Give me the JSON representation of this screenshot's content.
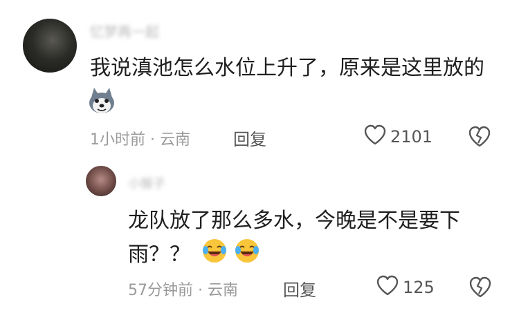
{
  "comments": [
    {
      "author": "忆梦再一起",
      "text": "我说滇池怎么水位上升了，原来是这里放的",
      "meta": "1小时前 · 云南",
      "reply_label": "回复",
      "likes": "2101",
      "emoji": "dog-face-icon"
    }
  ],
  "replies": [
    {
      "author": "小猴子",
      "text_line1": "龙队放了那么多水，今晚是不是要下",
      "text_line2": "雨？？",
      "meta": "57分钟前 · 云南",
      "reply_label": "回复",
      "likes": "125",
      "emoji": "laughing-crying-face-icon"
    }
  ],
  "colors": {
    "text": "#1f1f1f",
    "meta": "#9a9a9a",
    "action": "#555555"
  }
}
